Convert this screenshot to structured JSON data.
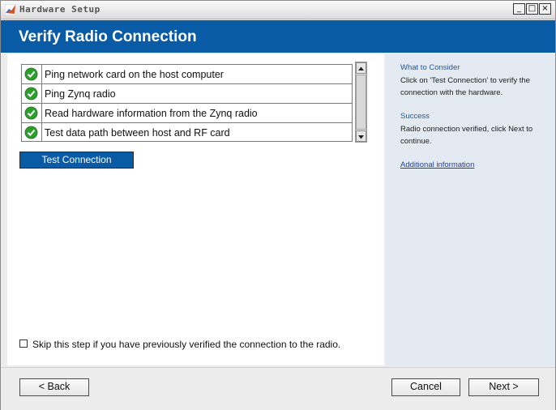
{
  "window": {
    "title": "Hardware Setup",
    "controls": {
      "minimize": "_",
      "maximize": "□",
      "close": "×"
    }
  },
  "header": {
    "title": "Verify Radio Connection"
  },
  "checks": [
    {
      "status": "passed",
      "icon": "green-check-icon",
      "label": "Ping network card on the host computer"
    },
    {
      "status": "passed",
      "icon": "green-check-icon",
      "label": "Ping Zynq radio"
    },
    {
      "status": "passed",
      "icon": "green-check-icon",
      "label": "Read hardware information from the Zynq radio"
    },
    {
      "status": "passed",
      "icon": "green-check-icon",
      "label": "Test data path between host and RF card"
    }
  ],
  "test_button": {
    "label": "Test Connection"
  },
  "skip_option": {
    "checked": false,
    "label": "Skip this step if you have previously verified the connection to the radio."
  },
  "side_panel": {
    "consider_heading": "What to Consider",
    "consider_text": "Click on 'Test Connection' to verify the connection with the hardware.",
    "success_heading": "Success",
    "success_text": "Radio connection verified, click Next to continue.",
    "link": "Additional information"
  },
  "footer": {
    "back": "< Back",
    "cancel": "Cancel",
    "next": "Next >"
  },
  "colors": {
    "accent": "#0a5ba6",
    "side_panel": "#e3eaf2",
    "check": "#2e9e2e"
  }
}
